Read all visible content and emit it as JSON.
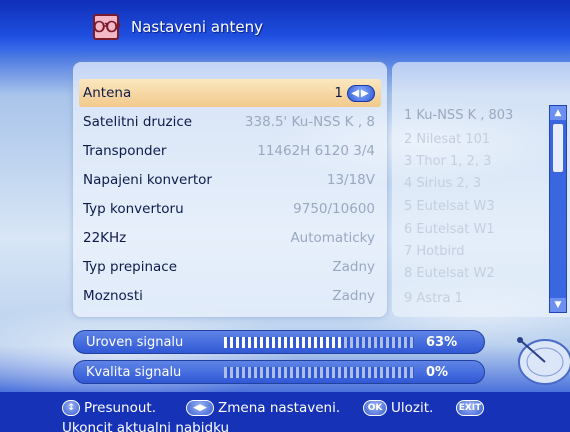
{
  "header": {
    "title": "Nastaveni anteny",
    "icon": "satellite-app-icon"
  },
  "settings": {
    "rows": [
      {
        "label": "Antena",
        "value": "1"
      },
      {
        "label": "Satelitni druzice",
        "value": "338.5' Ku-NSS K , 8"
      },
      {
        "label": "Transponder",
        "value": "11462H 6120 3/4"
      },
      {
        "label": "Napajeni konvertor",
        "value": "13/18V"
      },
      {
        "label": "Typ konvertoru",
        "value": "9750/10600"
      },
      {
        "label": "22KHz",
        "value": "Automaticky"
      },
      {
        "label": "Typ prepinace",
        "value": "Zadny"
      },
      {
        "label": "Moznosti",
        "value": "Zadny"
      }
    ]
  },
  "satellite_list": {
    "items": [
      "1 Ku-NSS K , 803",
      "2 Nilesat 101",
      "3 Thor 1, 2, 3",
      "4 Sirius 2, 3",
      "5 Eutelsat W3",
      "6 Eutelsat W1",
      "7 Hotbird",
      "8 Eutelsat W2",
      "9 Astra 1"
    ]
  },
  "signal": {
    "level_label": "Uroven signalu",
    "level_pct": "63%",
    "level_value": 0.63,
    "quality_label": "Kvalita signalu",
    "quality_pct": "0%",
    "quality_value": 0.0
  },
  "footer": {
    "move_label": "Presunout.",
    "change_label": "Zmena nastaveni.",
    "ok_key": "OK",
    "save_label": "Ulozit.",
    "exit_key": "EXIT",
    "line2": "Ukoncit aktualni nabidku"
  },
  "colors": {
    "accent": "#2c55d6",
    "highlight": "#f2c98c"
  }
}
